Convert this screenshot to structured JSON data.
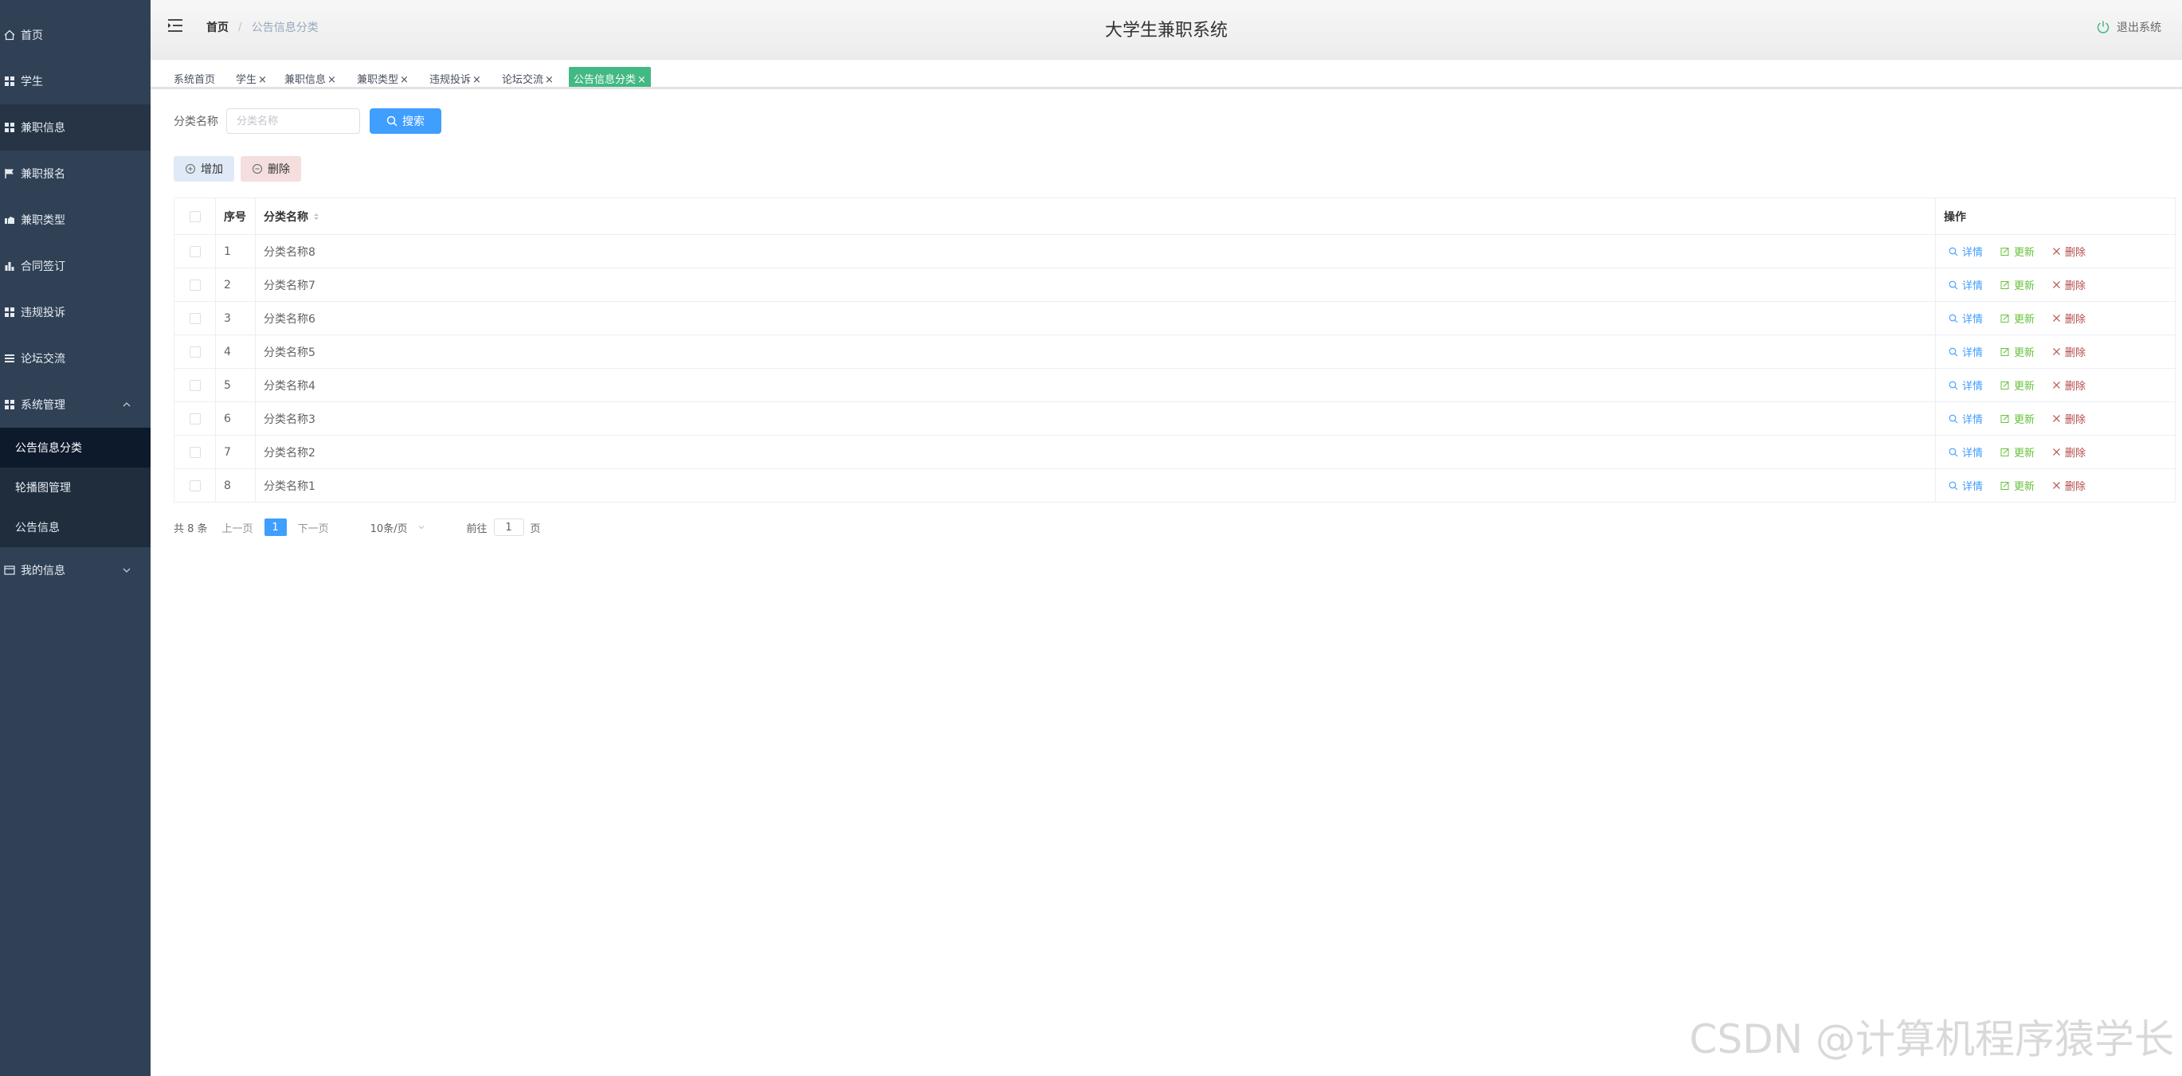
{
  "app": {
    "title": "大学生兼职系统",
    "logout_label": "退出系统"
  },
  "breadcrumb": {
    "home": "首页",
    "current": "公告信息分类"
  },
  "sidebar": {
    "items": [
      {
        "label": "首页",
        "icon": "home-icon"
      },
      {
        "label": "学生",
        "icon": "grid-icon"
      },
      {
        "label": "兼职信息",
        "icon": "grid-icon"
      },
      {
        "label": "兼职报名",
        "icon": "flag-icon"
      },
      {
        "label": "兼职类型",
        "icon": "cart-icon"
      },
      {
        "label": "合同签订",
        "icon": "chart-icon"
      },
      {
        "label": "违规投诉",
        "icon": "grid-icon"
      },
      {
        "label": "论坛交流",
        "icon": "list-icon"
      },
      {
        "label": "系统管理",
        "icon": "grid-icon"
      },
      {
        "label": "我的信息",
        "icon": "card-icon"
      }
    ],
    "system_submenu": [
      "公告信息分类",
      "轮播图管理",
      "公告信息"
    ]
  },
  "tabs": [
    {
      "label": "系统首页",
      "closable": false
    },
    {
      "label": "学生",
      "closable": true
    },
    {
      "label": "兼职信息",
      "closable": true
    },
    {
      "label": "兼职类型",
      "closable": true
    },
    {
      "label": "违规投诉",
      "closable": true
    },
    {
      "label": "论坛交流",
      "closable": true
    },
    {
      "label": "公告信息分类",
      "closable": true,
      "active": true
    }
  ],
  "search": {
    "label": "分类名称",
    "placeholder": "分类名称",
    "button": "搜索"
  },
  "actions": {
    "add": "增加",
    "delete": "删除"
  },
  "table": {
    "headers": {
      "index": "序号",
      "name": "分类名称",
      "ops": "操作"
    },
    "rows": [
      {
        "index": "1",
        "name": "分类名称8"
      },
      {
        "index": "2",
        "name": "分类名称7"
      },
      {
        "index": "3",
        "name": "分类名称6"
      },
      {
        "index": "4",
        "name": "分类名称5"
      },
      {
        "index": "5",
        "name": "分类名称4"
      },
      {
        "index": "6",
        "name": "分类名称3"
      },
      {
        "index": "7",
        "name": "分类名称2"
      },
      {
        "index": "8",
        "name": "分类名称1"
      }
    ],
    "ops": {
      "detail": "详情",
      "update": "更新",
      "delete": "删除"
    }
  },
  "pagination": {
    "total": "共 8 条",
    "prev": "上一页",
    "current": "1",
    "next": "下一页",
    "size": "10条/页",
    "goto_prefix": "前往",
    "goto_value": "1",
    "goto_suffix": "页"
  },
  "watermark": "CSDN @计算机程序猿学长",
  "colors": {
    "sidebar": "#304156",
    "primary": "#409eff",
    "success": "#67c23a",
    "active_tab": "#42b983",
    "danger": "#b54a4a"
  }
}
